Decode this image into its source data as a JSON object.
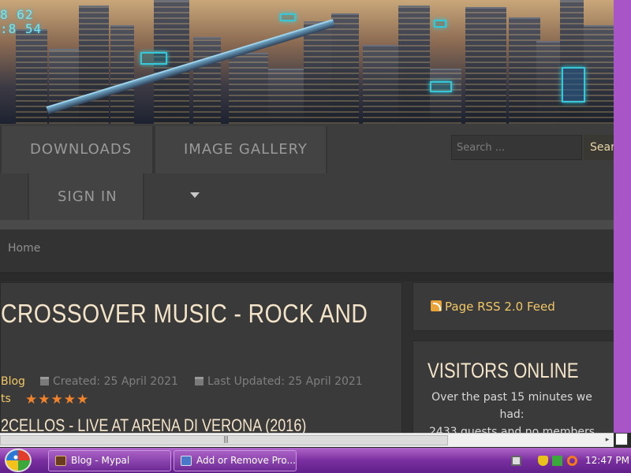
{
  "header": {
    "hud_readout": "8 62\n:8 54"
  },
  "nav": {
    "items": [
      {
        "label": "DOWNLOADS"
      },
      {
        "label": "IMAGE GALLERY"
      },
      {
        "label": "SIGN IN"
      }
    ],
    "search": {
      "placeholder": "Search ...",
      "button_label": "Searc"
    }
  },
  "breadcrumb": {
    "home": "Home"
  },
  "article": {
    "title": "CROSSOVER MUSIC - ROCK AND",
    "category": "Blog",
    "created": "Created: 25 April 2021",
    "updated": "Last Updated: 25 April 2021",
    "hits_label": "ts",
    "rating_stars": "★★★★★",
    "video_title": "2CELLOS - LIVE AT ARENA DI VERONA (2016)"
  },
  "sidebar": {
    "rss_label": "Page RSS 2.0 Feed",
    "visitors_title": "VISITORS ONLINE",
    "visitors_line1": "Over the past 15 minutes we had:",
    "visitors_line2": "2433 guests and no members"
  },
  "scrollbar": {
    "grip": "|||",
    "right_arrow": "▸"
  },
  "taskbar": {
    "tasks": [
      {
        "label": "Blog - Mypal"
      },
      {
        "label": "Add or Remove Pro..."
      }
    ],
    "clock": "12:47 PM"
  },
  "colors": {
    "accent_gold": "#f2c766",
    "heading_cream": "#f3e3c8",
    "star_orange": "#f0832b",
    "taskbar_purple": "#7a2fa0"
  }
}
